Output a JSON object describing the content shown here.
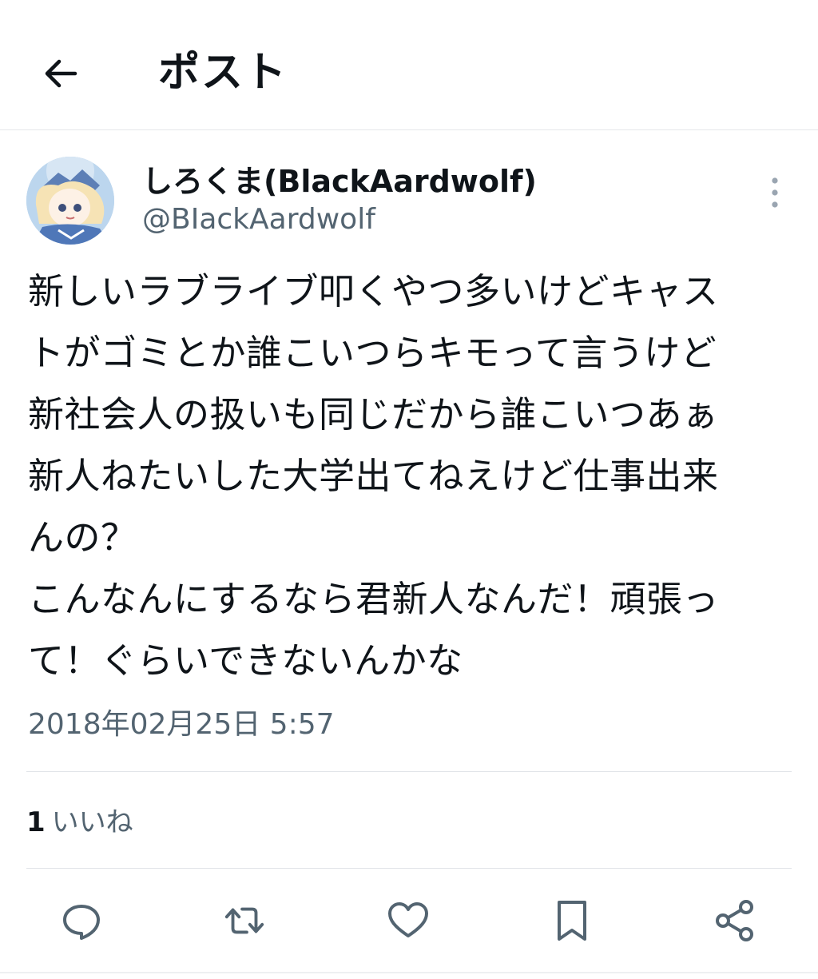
{
  "header": {
    "title": "ポスト",
    "back_icon": "arrow-left-icon"
  },
  "tweet": {
    "display_name": "しろくま(BlackAardwolf)",
    "handle": "@BIackAardwolf",
    "lines": [
      "新しいラブライブ叩くやつ多いけどキャス",
      "トがゴミとか誰こいつらキモって言うけど",
      "新社会人の扱いも同じだから誰こいつあぁ",
      "新人ねたいした大学出てねえけど仕事出来",
      "んの？",
      "こんなんにするなら君新人なんだ！頑張っ",
      "て！ぐらいできないんかな"
    ],
    "timestamp": "2018年02月25日 5:57"
  },
  "stats": {
    "likes_count": "1",
    "likes_label": "いいね"
  },
  "actions": {
    "icons": [
      "reply-icon",
      "repost-icon",
      "like-icon",
      "bookmark-icon",
      "share-icon"
    ]
  },
  "colors": {
    "text": "#0f1419",
    "secondary": "#536471",
    "divider": "#e1e4e8"
  }
}
